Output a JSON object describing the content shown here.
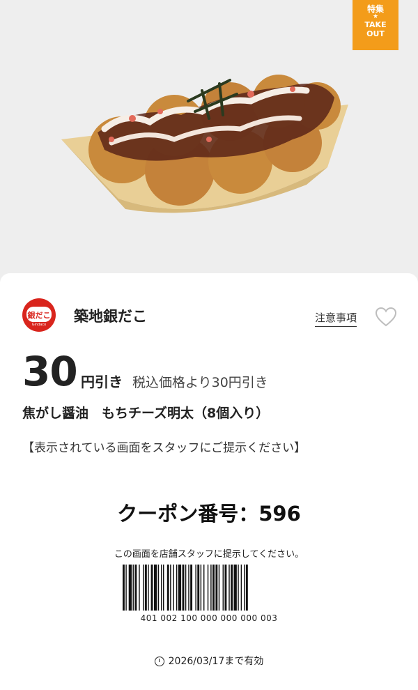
{
  "hero": {
    "badge_top": "特集",
    "badge_star": "★",
    "badge_take": "TAKE",
    "badge_out": "OUT"
  },
  "store": {
    "name": "築地銀だこ",
    "logo_text": "銀だこ",
    "logo_sub": "Gindaco"
  },
  "actions": {
    "notes_label": "注意事項",
    "favorite_icon": "heart-icon"
  },
  "discount": {
    "amount": "30",
    "unit": "円引き",
    "note": "税込価格より30円引き"
  },
  "product": {
    "name": "焦がし醤油　もちチーズ明太（8個入り）"
  },
  "instruction": "【表示されている画面をスタッフにご提示ください】",
  "coupon": {
    "label": "クーポン番号：",
    "number": "596"
  },
  "barcode": {
    "caption": "この画面を店舗スタッフに提示してください。",
    "number": "401 002 100 000 000 000 003"
  },
  "validity": {
    "text": "2026/03/17まで有効",
    "icon": "clock-icon"
  },
  "colors": {
    "badge": "#f39c1a",
    "logo": "#d9251d"
  }
}
